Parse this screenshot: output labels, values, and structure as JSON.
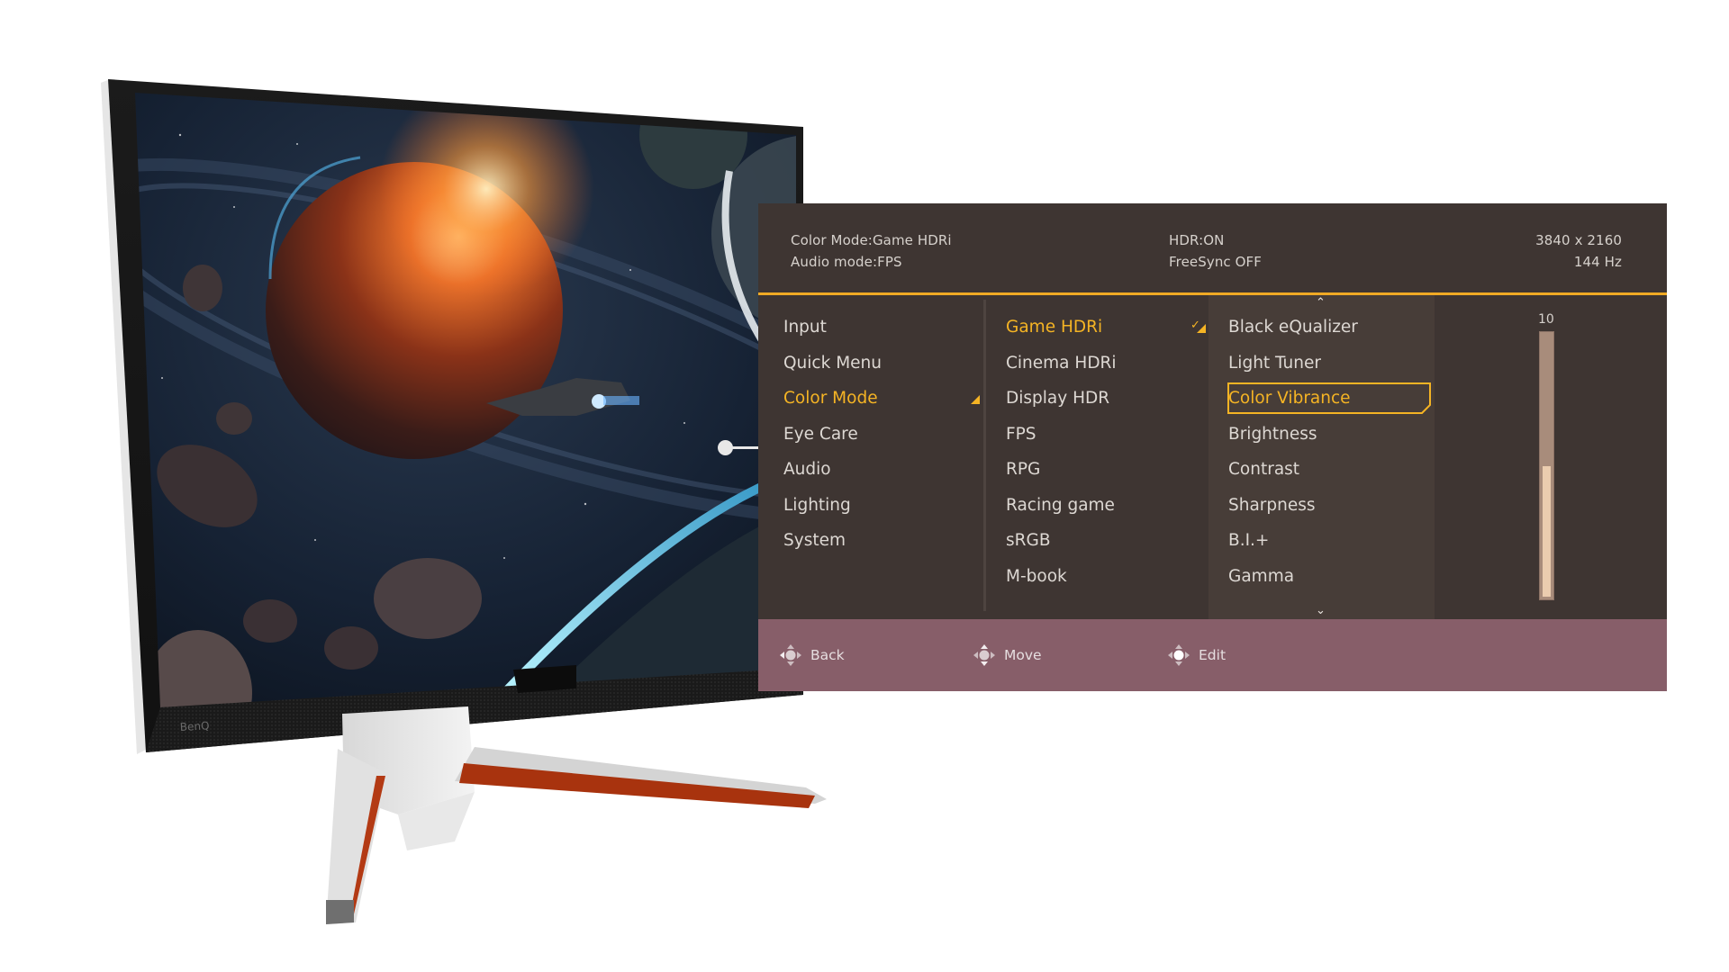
{
  "product": {
    "brand_logo": "BenQ"
  },
  "osd": {
    "header": {
      "color_mode_status": "Color Mode:Game HDRi",
      "audio_mode_status": "Audio mode:FPS",
      "hdr_status": "HDR:ON",
      "freesync_status": "FreeSync OFF",
      "resolution": "3840 x 2160",
      "refresh_rate": "144 Hz"
    },
    "main_menu": {
      "items": [
        {
          "label": "Input"
        },
        {
          "label": "Quick Menu"
        },
        {
          "label": "Color Mode",
          "active": true
        },
        {
          "label": "Eye Care"
        },
        {
          "label": "Audio"
        },
        {
          "label": "Lighting"
        },
        {
          "label": "System"
        }
      ]
    },
    "color_mode_menu": {
      "items": [
        {
          "label": "Game HDRi",
          "active": true,
          "checked": true
        },
        {
          "label": "Cinema HDRi"
        },
        {
          "label": "Display HDR"
        },
        {
          "label": "FPS"
        },
        {
          "label": "RPG"
        },
        {
          "label": "Racing game"
        },
        {
          "label": "sRGB"
        },
        {
          "label": "M-book"
        }
      ]
    },
    "settings_menu": {
      "scroll_up_icon": "chevron-up-icon",
      "scroll_down_icon": "chevron-down-icon",
      "items": [
        {
          "label": "Black eQualizer"
        },
        {
          "label": "Light Tuner"
        },
        {
          "label": "Color Vibrance",
          "selected": true
        },
        {
          "label": "Brightness"
        },
        {
          "label": "Contrast"
        },
        {
          "label": "Sharpness"
        },
        {
          "label": "B.I.+"
        },
        {
          "label": "Gamma"
        }
      ]
    },
    "slider": {
      "setting": "Color Vibrance",
      "value_label": "10",
      "fill_fraction": 0.5
    },
    "footer": {
      "back_label": "Back",
      "move_label": "Move",
      "edit_label": "Edit",
      "back_icon": "joystick-left-icon",
      "move_icon": "joystick-updown-icon",
      "edit_icon": "joystick-press-icon"
    },
    "colors": {
      "background": "#3e3532",
      "column_highlight": "#473d38",
      "accent": "#f5b424",
      "footer": "#875e69",
      "text": "#ddd8d3",
      "slider_track": "#a88c7b",
      "slider_fill": "#ebcdaf"
    }
  }
}
